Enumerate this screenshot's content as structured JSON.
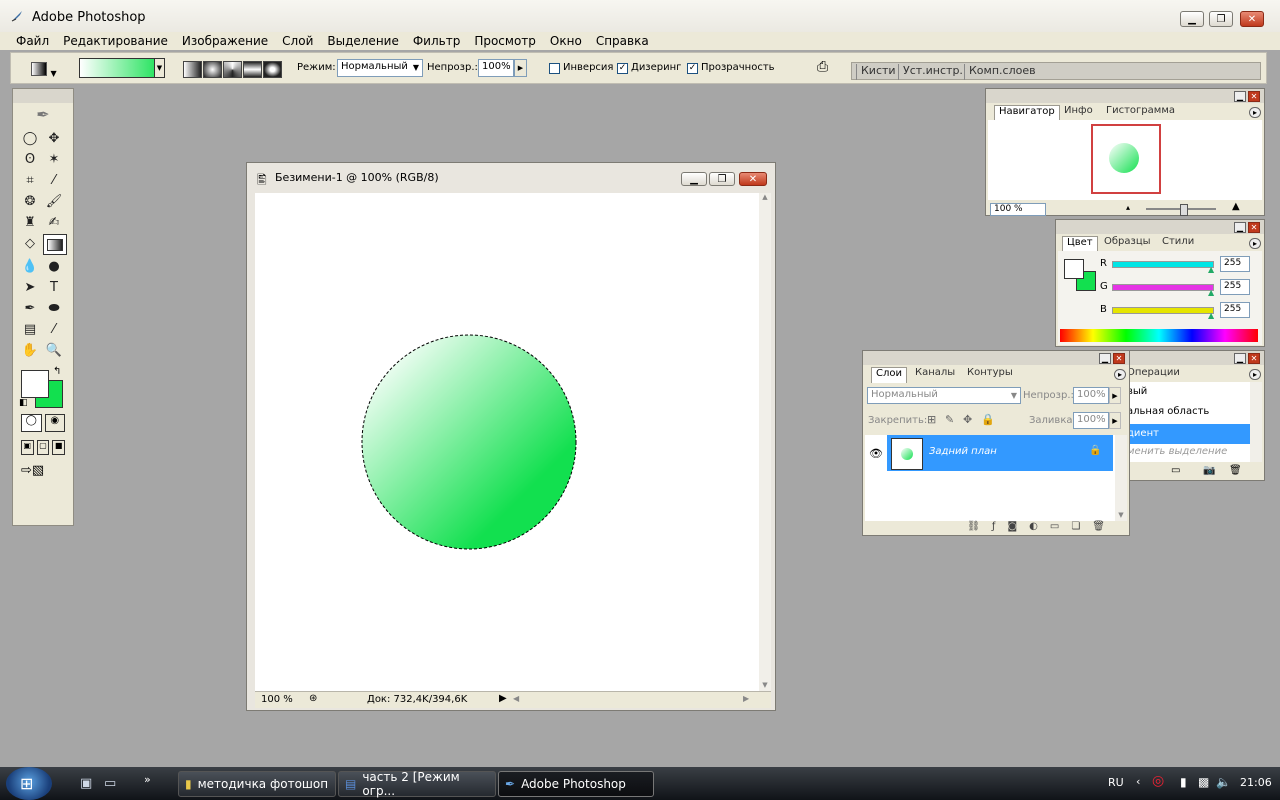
{
  "app": {
    "title": "Adobe Photoshop"
  },
  "menu": [
    "Файл",
    "Редактирование",
    "Изображение",
    "Слой",
    "Выделение",
    "Фильтр",
    "Просмотр",
    "Окно",
    "Справка"
  ],
  "options": {
    "mode_label": "Режим:",
    "mode_value": "Нормальный",
    "opacity_label": "Непрозр.:",
    "opacity_value": "100%",
    "inverse_label": "Инверсия",
    "dither_label": "Дизеринг",
    "transparency_label": "Прозрачность",
    "inverse_checked": false,
    "dither_checked": true,
    "transparency_checked": true,
    "gradient_start": "#ffffff",
    "gradient_end": "#12e04f"
  },
  "palette_well": [
    "Кисти",
    "Уст.инстр.",
    "Комп.слоев"
  ],
  "document": {
    "title": "Безимени-1 @ 100% (RGB/8)",
    "zoom": "100 %",
    "doc_info": "Док: 732,4K/394,6K"
  },
  "navigator": {
    "tabs": [
      "Навигатор",
      "Инфо",
      "Гистограмма"
    ],
    "active_tab": 0,
    "zoom": "100 %"
  },
  "color_panel": {
    "tabs": [
      "Цвет",
      "Образцы",
      "Стили"
    ],
    "active_tab": 0,
    "channels": [
      {
        "label": "R",
        "value": "255",
        "color": "#00e5e5"
      },
      {
        "label": "G",
        "value": "255",
        "color": "#e534e5"
      },
      {
        "label": "B",
        "value": "255",
        "color": "#e5e500"
      }
    ],
    "foreground": "#ffffff",
    "background": "#12e04f"
  },
  "history_panel": {
    "tab": "Операции",
    "items": [
      "вый",
      "альная область",
      "диент",
      "менить выделение"
    ],
    "selected": 2
  },
  "layers_panel": {
    "tabs": [
      "Слои",
      "Каналы",
      "Контуры"
    ],
    "active_tab": 0,
    "blend_mode": "Нормальный",
    "opacity_label": "Непрозр.:",
    "opacity_value": "100%",
    "lock_label": "Закрепить:",
    "fill_label": "Заливка:",
    "fill_value": "100%",
    "layers": [
      {
        "name": "Задний план",
        "locked": true,
        "visible": true
      }
    ]
  },
  "taskbar": {
    "tasks": [
      "методичка фотошоп",
      "часть 2 [Режим огр...",
      "Adobe Photoshop"
    ],
    "active_task": 2,
    "language": "RU",
    "time": "21:06"
  },
  "colors": {
    "selection_blue": "#3399ff",
    "circle_green": "#12e04f"
  }
}
